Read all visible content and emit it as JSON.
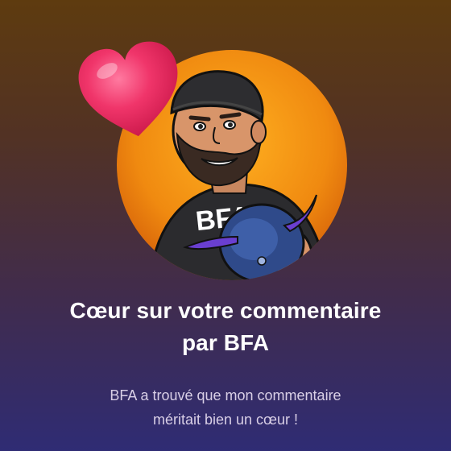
{
  "notification": {
    "title_line1": "Cœur sur votre commentaire",
    "title_line2": "par BFA",
    "body_line1": "BFA a trouvé que mon commentaire",
    "body_line2": "méritait bien un cœur !"
  },
  "avatar": {
    "shirt_text": "BFA",
    "icon": "creator-avatar-illustration"
  },
  "badge": {
    "icon": "heart-icon"
  },
  "colors": {
    "heart": "#f0356a",
    "avatar_ring": "#f39a12",
    "title_text": "#ffffff",
    "body_text": "#d9cfe6"
  }
}
